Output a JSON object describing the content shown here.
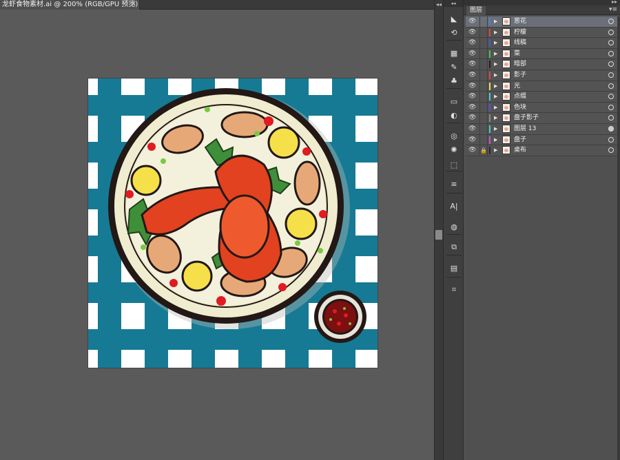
{
  "document": {
    "tab_title": "龙虾食物素材.ai @ 200% (RGB/GPU 预览)",
    "close_glyph": "×"
  },
  "layers_panel": {
    "tab_label": "图层",
    "layers": [
      {
        "name": "葱花",
        "color": "#4f7fd8",
        "selected": true,
        "locked": false,
        "target_filled": false
      },
      {
        "name": "柠檬",
        "color": "#e04646",
        "selected": false,
        "locked": false,
        "target_filled": false
      },
      {
        "name": "线稿",
        "color": "#3f62d8",
        "selected": false,
        "locked": false,
        "target_filled": false
      },
      {
        "name": "菜",
        "color": "#3cc84a",
        "selected": false,
        "locked": false,
        "target_filled": false
      },
      {
        "name": "暗部",
        "color": "#222222",
        "selected": false,
        "locked": false,
        "target_filled": false
      },
      {
        "name": "影子",
        "color": "#e04646",
        "selected": false,
        "locked": false,
        "target_filled": false
      },
      {
        "name": "光",
        "color": "#e8e04a",
        "selected": false,
        "locked": false,
        "target_filled": false
      },
      {
        "name": "点缀",
        "color": "#3fd0d0",
        "selected": false,
        "locked": false,
        "target_filled": false
      },
      {
        "name": "色块",
        "color": "#5c4fd8",
        "selected": false,
        "locked": false,
        "target_filled": false
      },
      {
        "name": "盘子影子",
        "color": "#8a8a8a",
        "selected": false,
        "locked": false,
        "target_filled": false
      },
      {
        "name": "图层 13",
        "color": "#3fd0d0",
        "selected": false,
        "locked": false,
        "target_filled": true
      },
      {
        "name": "盘子",
        "color": "#d04fd8",
        "selected": false,
        "locked": false,
        "target_filled": false
      },
      {
        "name": "桌布",
        "color": "#2b2b2b",
        "selected": false,
        "locked": true,
        "target_filled": false
      }
    ]
  },
  "tools": [
    {
      "name": "shape-builder-tool-icon",
      "glyph": "◣"
    },
    {
      "name": "transform-tool-icon",
      "glyph": "⟲"
    },
    {
      "name": "swatches-icon",
      "glyph": "▦"
    },
    {
      "name": "brushes-icon",
      "glyph": "✎"
    },
    {
      "name": "symbols-icon",
      "glyph": "♣"
    },
    {
      "name": "gradient-icon",
      "glyph": "▭"
    },
    {
      "name": "transparency-icon",
      "glyph": "◐"
    },
    {
      "name": "appearance-icon",
      "glyph": "◎"
    },
    {
      "name": "graphic-styles-icon",
      "glyph": "✺"
    },
    {
      "name": "image-trace-icon",
      "glyph": "⬚"
    },
    {
      "name": "align-icon",
      "glyph": "≡"
    },
    {
      "name": "character-icon",
      "glyph": "A|"
    },
    {
      "name": "color-guide-icon",
      "glyph": "◍"
    },
    {
      "name": "pathfinder-icon",
      "glyph": "⧉"
    },
    {
      "name": "artboards-icon",
      "glyph": "▤"
    },
    {
      "name": "links-icon",
      "glyph": "⌗"
    }
  ],
  "colors": {
    "tablecloth_blue": "#167a94",
    "plate_outline": "#231815",
    "plate_fill": "#efeccf",
    "lobster_red": "#e2421f",
    "lemon_yellow": "#f5e04a",
    "mussel_tan": "#e7a878",
    "herb_green": "#3f8e3a"
  }
}
